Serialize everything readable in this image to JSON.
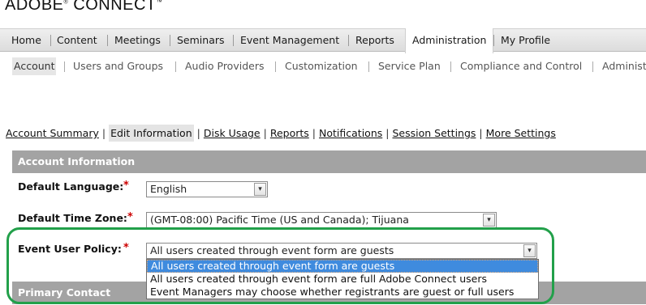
{
  "brand": {
    "name": "ADOBE",
    "mark": "®",
    "product": "CONNECT",
    "tm": "™"
  },
  "topnav": {
    "items": [
      {
        "label": "Home"
      },
      {
        "label": "Content"
      },
      {
        "label": "Meetings"
      },
      {
        "label": "Seminars"
      },
      {
        "label": "Event Management"
      },
      {
        "label": "Reports"
      },
      {
        "label": "Administration",
        "active": true
      },
      {
        "label": "My Profile"
      }
    ]
  },
  "subnav": {
    "items": [
      {
        "label": "Account",
        "active": true
      },
      {
        "label": "Users and Groups"
      },
      {
        "label": "Audio Providers"
      },
      {
        "label": "Customization"
      },
      {
        "label": "Service Plan"
      },
      {
        "label": "Compliance and Control"
      },
      {
        "label": "Administ"
      }
    ]
  },
  "account_links": {
    "separator": "|",
    "items": [
      {
        "label": "Account Summary"
      },
      {
        "label": "Edit Information",
        "current": true
      },
      {
        "label": "Disk Usage"
      },
      {
        "label": "Reports"
      },
      {
        "label": "Notifications"
      },
      {
        "label": "Session Settings"
      },
      {
        "label": "More Settings"
      }
    ]
  },
  "sections": {
    "account_info": "Account Information",
    "primary_contact": "Primary Contact"
  },
  "form": {
    "required_mark": "*",
    "arrow_glyph": "▾",
    "language": {
      "label": "Default Language:",
      "value": "English"
    },
    "timezone": {
      "label": "Default Time Zone:",
      "value": "(GMT-08:00) Pacific Time (US and Canada); Tijuana"
    },
    "event_policy": {
      "label": "Event User Policy:",
      "value": "All users created through event form are guests",
      "options": [
        "All users created through event form are guests",
        "All users created through event form are full Adobe Connect users",
        "Event Managers may choose whether registrants are guest or full users"
      ],
      "selected_index": 0
    }
  },
  "colors": {
    "highlight": "#22a04a",
    "section_header": "#a3a3a3",
    "dropdown_selected": "#3f8bde",
    "required": "#cc0000"
  }
}
